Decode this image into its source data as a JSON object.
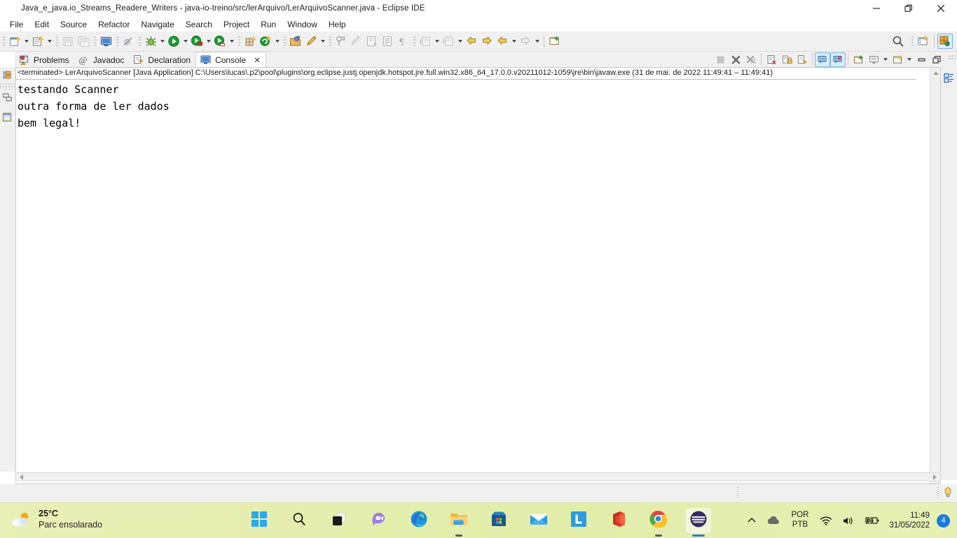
{
  "window": {
    "title": "Java_e_java.io_Streams_Readere_Writers - java-io-treino/src/lerArquivo/LerArquivoScanner.java - Eclipse IDE",
    "app_icon": "eclipse-icon",
    "controls": {
      "minimize": "–",
      "restore": "❐",
      "close": "✕"
    }
  },
  "menubar": {
    "items": [
      {
        "label": "File"
      },
      {
        "label": "Edit"
      },
      {
        "label": "Source"
      },
      {
        "label": "Refactor"
      },
      {
        "label": "Navigate"
      },
      {
        "label": "Search"
      },
      {
        "label": "Project"
      },
      {
        "label": "Run"
      },
      {
        "label": "Window"
      },
      {
        "label": "Help"
      }
    ]
  },
  "toolbar": {
    "items": [
      {
        "name": "new-wizard-icon",
        "tooltip": "New"
      },
      {
        "name": "new-java-class-icon",
        "tooltip": "New Java Class"
      },
      {
        "name": "save-icon",
        "tooltip": "Save"
      },
      {
        "name": "save-all-icon",
        "tooltip": "Save All"
      },
      {
        "name": "open-console-icon",
        "tooltip": "Open Console"
      },
      {
        "name": "skip-breakpoints-icon",
        "tooltip": "Skip All Breakpoints"
      },
      {
        "name": "debug-icon",
        "tooltip": "Debug"
      },
      {
        "name": "run-icon",
        "tooltip": "Run"
      },
      {
        "name": "run-coverage-icon",
        "tooltip": "Coverage"
      },
      {
        "name": "run-external-tools-icon",
        "tooltip": "External Tools"
      },
      {
        "name": "new-package-icon",
        "tooltip": "New Package"
      },
      {
        "name": "new-project-icon",
        "tooltip": "New Project"
      },
      {
        "name": "open-type-icon",
        "tooltip": "Open Type"
      },
      {
        "name": "search-marker-icon",
        "tooltip": "Search"
      },
      {
        "name": "pin-editor-icon",
        "tooltip": "Pin Editor"
      },
      {
        "name": "toggle-mark-occurrences-icon",
        "tooltip": "Toggle Mark Occurrences"
      },
      {
        "name": "toggle-block-selection-icon",
        "tooltip": "Toggle Block Selection"
      },
      {
        "name": "show-whitespace-icon",
        "tooltip": "Show Whitespace Characters"
      },
      {
        "name": "pilcrow-icon",
        "tooltip": "Show Print Margin"
      },
      {
        "name": "next-annotation-icon",
        "tooltip": "Next Annotation"
      },
      {
        "name": "previous-annotation-icon",
        "tooltip": "Previous Annotation"
      },
      {
        "name": "back-icon",
        "tooltip": "Back"
      },
      {
        "name": "forward-icon",
        "tooltip": "Forward"
      },
      {
        "name": "previous-edit-icon",
        "tooltip": "Previous Edit Location"
      },
      {
        "name": "next-edit-icon",
        "tooltip": "Next Edit Location"
      },
      {
        "name": "new-window-icon",
        "tooltip": "New Window"
      }
    ],
    "right": [
      {
        "name": "search-icon",
        "tooltip": "Search"
      },
      {
        "name": "open-perspective-icon",
        "tooltip": "Open Perspective"
      },
      {
        "name": "java-perspective-icon",
        "tooltip": "Java Perspective"
      }
    ]
  },
  "leftbar": {
    "items": [
      {
        "name": "package-explorer-icon"
      },
      {
        "name": "hierarchy-icon"
      },
      {
        "name": "outline-icon"
      }
    ]
  },
  "rightdock": {
    "items": [
      {
        "name": "outline-view-icon"
      }
    ]
  },
  "tabs": [
    {
      "label": "Problems",
      "icon": "problems-icon",
      "active": false,
      "closable": false
    },
    {
      "label": "Javadoc",
      "icon": "javadoc-icon",
      "active": false,
      "closable": false
    },
    {
      "label": "Declaration",
      "icon": "declaration-icon",
      "active": false,
      "closable": false
    },
    {
      "label": "Console",
      "icon": "console-icon",
      "active": true,
      "closable": true
    }
  ],
  "view_toolbar": {
    "items": [
      {
        "name": "terminate-icon",
        "enabled": false,
        "selected": false
      },
      {
        "name": "remove-launch-icon",
        "enabled": true,
        "selected": false
      },
      {
        "name": "remove-all-launches-icon",
        "enabled": true,
        "selected": false
      },
      {
        "name": "clear-console-icon",
        "enabled": true,
        "selected": false
      },
      {
        "name": "scroll-lock-icon",
        "enabled": true,
        "selected": false
      },
      {
        "name": "word-wrap-icon",
        "enabled": true,
        "selected": false
      },
      {
        "name": "show-console-on-output-icon",
        "enabled": true,
        "selected": true
      },
      {
        "name": "show-console-on-error-icon",
        "enabled": true,
        "selected": true
      },
      {
        "name": "pin-console-icon",
        "enabled": true,
        "selected": false
      },
      {
        "name": "display-selected-console-icon",
        "enabled": true,
        "selected": false
      },
      {
        "name": "open-console-menu-icon",
        "enabled": true,
        "selected": false
      },
      {
        "name": "minimize-view-icon",
        "enabled": true,
        "selected": false
      },
      {
        "name": "maximize-view-icon",
        "enabled": true,
        "selected": false
      }
    ]
  },
  "console": {
    "header": {
      "status": "<terminated>",
      "launch": "LerArquivoScanner [Java Application]",
      "path": "C:\\Users\\lucas\\.p2\\pool\\plugins\\org.eclipse.justj.openjdk.hotspot.jre.full.win32.x86_64_17.0.0.v20211012-1059\\jre\\bin\\javaw.exe",
      "timestamp": "(31 de mai. de 2022 11:49:41 – 11:49:41)",
      "full": "<terminated> LerArquivoScanner [Java Application] C:\\Users\\lucas\\.p2\\pool\\plugins\\org.eclipse.justj.openjdk.hotspot.jre.full.win32.x86_64_17.0.0.v20211012-1059\\jre\\bin\\javaw.exe  (31 de mai. de 2022 11:49:41 – 11:49:41)"
    },
    "output_lines": [
      "testando Scanner",
      "outra forma de ler dados",
      "bem legal!"
    ],
    "output": "testando Scanner\noutra forma de ler dados\nbem legal!"
  },
  "taskbar": {
    "weather": {
      "temperature": "25°C",
      "description": "Parc ensolarado",
      "icon": "sun-cloud-icon"
    },
    "apps": [
      {
        "name": "start-button",
        "icon": "windows-logo-icon",
        "running": false,
        "focused": false
      },
      {
        "name": "taskbar-search",
        "icon": "search-icon",
        "running": false,
        "focused": false
      },
      {
        "name": "task-view",
        "icon": "task-view-icon",
        "running": false,
        "focused": false
      },
      {
        "name": "chat-teams",
        "icon": "chat-icon",
        "running": false,
        "focused": false
      },
      {
        "name": "microsoft-edge",
        "icon": "edge-icon",
        "running": false,
        "focused": false
      },
      {
        "name": "file-explorer",
        "icon": "folder-icon",
        "running": true,
        "focused": false
      },
      {
        "name": "microsoft-store",
        "icon": "store-icon",
        "running": false,
        "focused": false
      },
      {
        "name": "mail",
        "icon": "mail-icon",
        "running": false,
        "focused": false
      },
      {
        "name": "linkedin",
        "icon": "linkedin-icon",
        "running": false,
        "focused": false
      },
      {
        "name": "microsoft-office",
        "icon": "office-icon",
        "running": false,
        "focused": false
      },
      {
        "name": "google-chrome",
        "icon": "chrome-icon",
        "running": true,
        "focused": false
      },
      {
        "name": "eclipse-ide",
        "icon": "eclipse-icon",
        "running": true,
        "focused": true
      }
    ],
    "tray": {
      "show_hidden": "^",
      "cloud_icon": "onedrive-icon",
      "language_top": "POR",
      "language_bottom": "PTB",
      "network_icon": "wifi-icon",
      "volume_icon": "speaker-icon",
      "battery_icon": "battery-charging-icon",
      "time": "11:49",
      "date": "31/05/2022",
      "notification_count": "4"
    }
  },
  "colors": {
    "accent": "#1a7ae0",
    "taskbar_bg": "#e4eeab",
    "toolbar_bg": "#f0f0f0",
    "console_bg": "#ffffff",
    "selected_tool": "#dbeeff"
  }
}
